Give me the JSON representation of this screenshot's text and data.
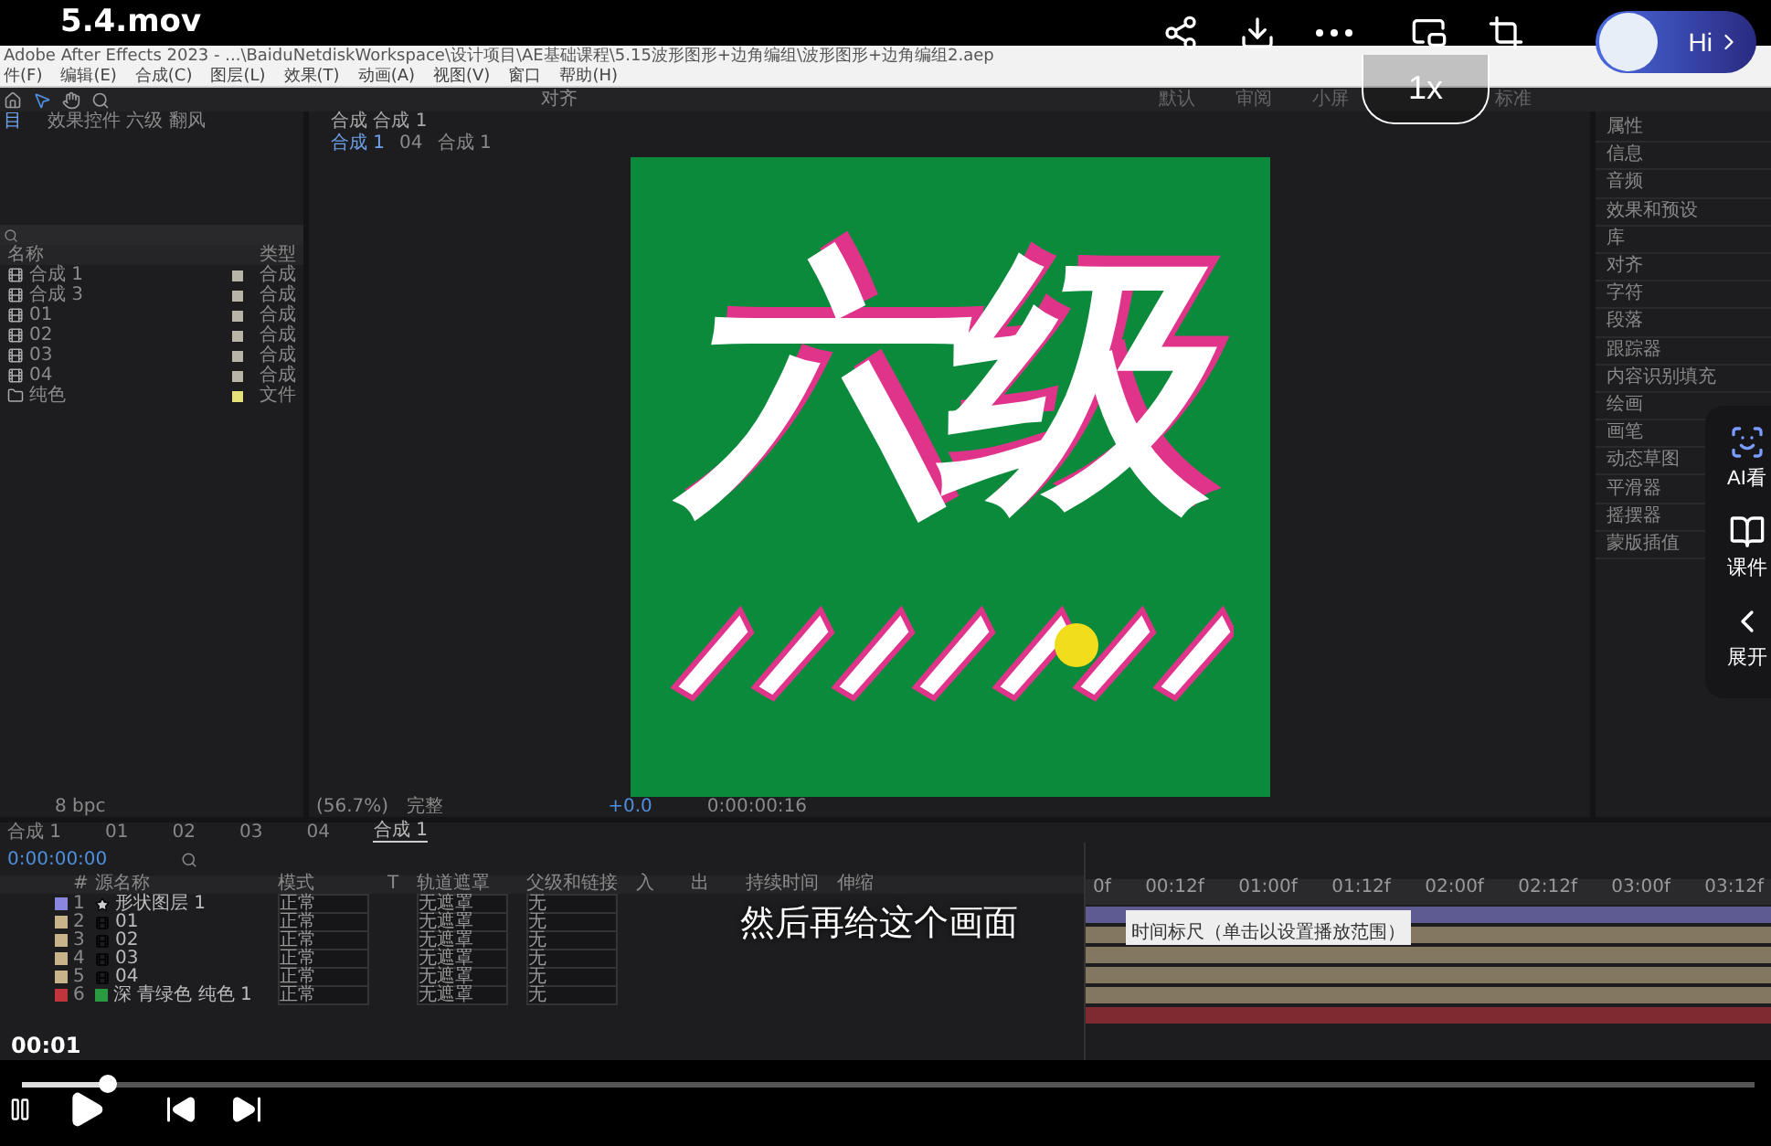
{
  "player": {
    "title": "5.4.mov",
    "speed": "1x",
    "greeting": "Hi",
    "subtitle": "然后再给这个画面",
    "time_current": "00:01",
    "progress": {
      "level": 0.05
    },
    "side_actions": [
      {
        "kind": "ai",
        "label": "AI看"
      },
      {
        "kind": "doc",
        "label": "课件"
      },
      {
        "kind": "expand",
        "label": "展开"
      }
    ]
  },
  "app": {
    "title": "Adobe After Effects 2023 - ...\\BaiduNetdiskWorkspace\\设计项目\\AE基础课程\\5.15波形图形+边角编组\\波形图形+边角编组2.aep",
    "menu": [
      "件(F)",
      "编辑(E)",
      "合成(C)",
      "图层(L)",
      "效果(T)",
      "动画(A)",
      "视图(V)",
      "窗口",
      "帮助(H)"
    ],
    "align_label": "对齐",
    "workspaces": [
      {
        "label": "默认",
        "selected": false
      },
      {
        "label": "审阅",
        "selected": false
      },
      {
        "label": "小屏",
        "selected": false
      },
      {
        "label": "标准",
        "selected": false
      }
    ],
    "project": {
      "tabs": [
        {
          "label": "目",
          "selected": true
        },
        {
          "label": "效果控件 六级 翻风",
          "selected": false
        }
      ],
      "columns": [
        "名称",
        "类型"
      ],
      "items": [
        {
          "kind": "comp",
          "name": "合成 1",
          "type": "合成",
          "color": "#b8b4a8"
        },
        {
          "kind": "comp",
          "name": "合成 3",
          "type": "合成",
          "color": "#b8b4a8"
        },
        {
          "kind": "comp",
          "name": "01",
          "type": "合成",
          "color": "#b8b4a8"
        },
        {
          "kind": "comp",
          "name": "02",
          "type": "合成",
          "color": "#b8b4a8"
        },
        {
          "kind": "comp",
          "name": "03",
          "type": "合成",
          "color": "#b8b4a8"
        },
        {
          "kind": "comp",
          "name": "04",
          "type": "合成",
          "color": "#b8b4a8"
        },
        {
          "kind": "folder",
          "name": "纯色",
          "type": "文件",
          "color": "#e6e27a"
        }
      ],
      "footer": "8 bpc"
    },
    "viewer": {
      "tab": "合成 合成 1",
      "breadcrumbs": [
        {
          "label": "合成 1",
          "selected": true
        },
        {
          "label": "04",
          "selected": false
        },
        {
          "label": "合成 1",
          "selected": false
        }
      ],
      "headline": "六级",
      "zoom": "(56.7%)",
      "quality": "完整",
      "exposure": "+0.0",
      "timecode": "0:00:00:16"
    },
    "panels": [
      "属性",
      "信息",
      "音频",
      "效果和预设",
      "库",
      "对齐",
      "字符",
      "段落",
      "跟踪器",
      "内容识别填充",
      "绘画",
      "画笔",
      "动态草图",
      "平滑器",
      "摇摆器",
      "蒙版插值"
    ],
    "timeline": {
      "tabs": [
        {
          "label": "合成 1",
          "selected": false
        },
        {
          "label": "01",
          "selected": false
        },
        {
          "label": "02",
          "selected": false
        },
        {
          "label": "03",
          "selected": false
        },
        {
          "label": "04",
          "selected": false
        },
        {
          "label": "合成 1",
          "selected": true
        }
      ],
      "timecode": "0:00:00:00",
      "columns": [
        "#",
        "源名称",
        "模式",
        "T",
        "轨道遮罩",
        "父级和链接",
        "入",
        "出",
        "持续时间",
        "伸缩"
      ],
      "layers": [
        {
          "index": "1",
          "kind": "shape",
          "name": "形状图层 1",
          "mode": "正常",
          "mask": "无遮罩",
          "parent": "无",
          "color": "#8a86e0"
        },
        {
          "index": "2",
          "kind": "comp",
          "name": "01",
          "mode": "正常",
          "mask": "无遮罩",
          "parent": "无",
          "color": "#c8b48a"
        },
        {
          "index": "3",
          "kind": "comp",
          "name": "02",
          "mode": "正常",
          "mask": "无遮罩",
          "parent": "无",
          "color": "#c8b48a"
        },
        {
          "index": "4",
          "kind": "comp",
          "name": "03",
          "mode": "正常",
          "mask": "无遮罩",
          "parent": "无",
          "color": "#c8b48a"
        },
        {
          "index": "5",
          "kind": "comp",
          "name": "04",
          "mode": "正常",
          "mask": "无遮罩",
          "parent": "无",
          "color": "#c8b48a"
        },
        {
          "index": "6",
          "kind": "solid",
          "name": "深 青绿色 纯色 1",
          "mode": "正常",
          "mask": "无遮罩",
          "parent": "无",
          "color": "#c0343c"
        }
      ],
      "ruler": [
        "0f",
        "00:12f",
        "01:00f",
        "01:12f",
        "02:00f",
        "02:12f",
        "03:00f",
        "03:12f"
      ],
      "tooltip": "时间标尺（单击以设置播放范围）"
    }
  }
}
